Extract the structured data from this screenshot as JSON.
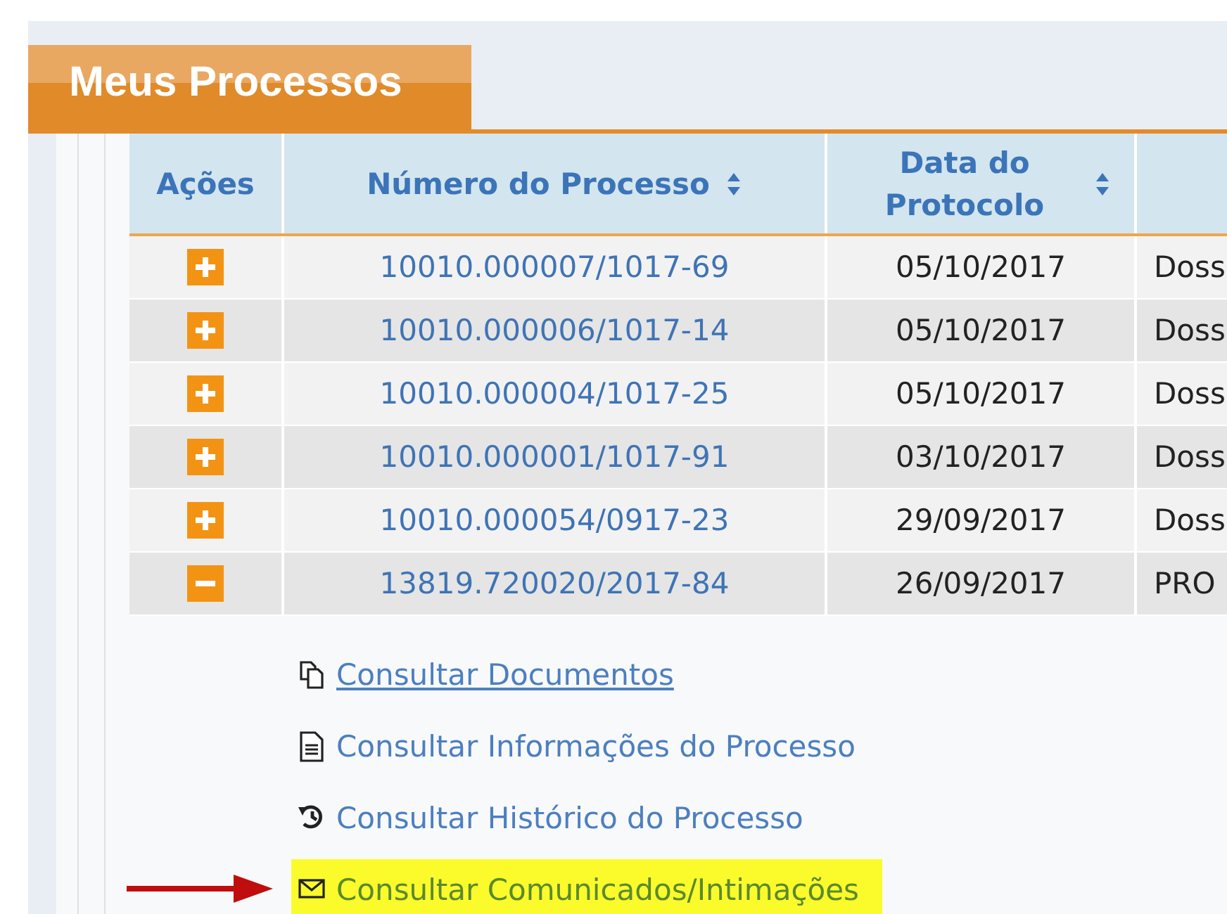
{
  "tab": {
    "label": "Meus Processos",
    "selected": true
  },
  "table": {
    "columns": [
      {
        "label": "Ações",
        "sortable": false
      },
      {
        "label": "Número do Processo",
        "sortable": true
      },
      {
        "label": "Data do Protocolo",
        "sortable": true
      },
      {
        "sortable": false
      }
    ],
    "rows": [
      {
        "expanded": false,
        "numero": "10010.000007/1017-69",
        "data": "05/10/2017",
        "column_4": "Doss"
      },
      {
        "expanded": false,
        "numero": "10010.000006/1017-14",
        "data": "05/10/2017",
        "column_4": "Doss"
      },
      {
        "expanded": false,
        "numero": "10010.000004/1017-25",
        "data": "05/10/2017",
        "column_4": "Doss"
      },
      {
        "expanded": false,
        "numero": "10010.000001/1017-91",
        "data": "03/10/2017",
        "column_4": "Doss"
      },
      {
        "expanded": false,
        "numero": "10010.000054/0917-23",
        "data": "29/09/2017",
        "column_4": "Doss"
      },
      {
        "expanded": true,
        "numero": "13819.720020/2017-84",
        "data": "26/09/2017",
        "column_4": "PRO"
      }
    ]
  },
  "actions": [
    {
      "kind": "documents",
      "label": "Consultar Documentos",
      "hovered": true,
      "highlighted": false
    },
    {
      "kind": "info",
      "label": "Consultar Informações do Processo",
      "hovered": false,
      "highlighted": false
    },
    {
      "kind": "history",
      "label": "Consultar Histórico do Processo",
      "hovered": false,
      "highlighted": false
    },
    {
      "kind": "mail",
      "label": "Consultar Comunicados/Intimações",
      "hovered": false,
      "highlighted": true
    }
  ]
}
